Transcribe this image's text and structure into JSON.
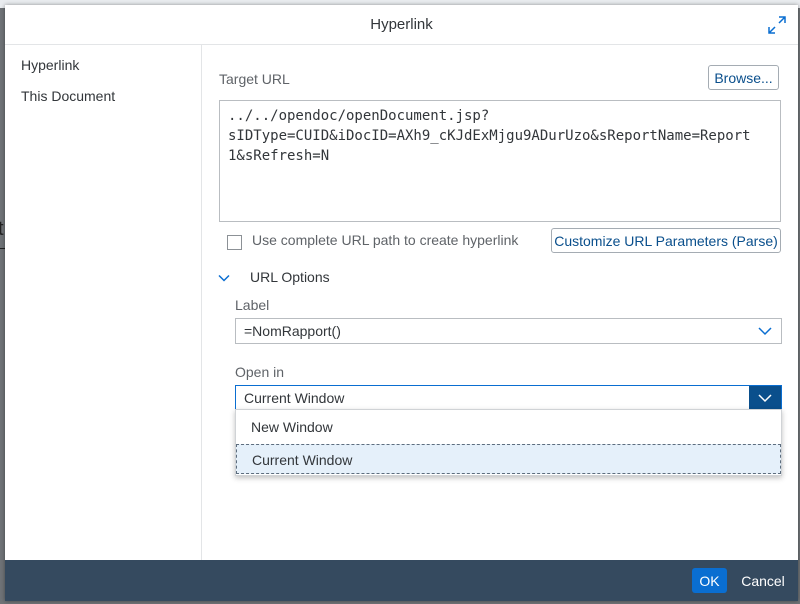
{
  "dialog": {
    "title": "Hyperlink",
    "expand_icon": "expand-icon"
  },
  "nav": {
    "items": [
      {
        "label": "Hyperlink"
      },
      {
        "label": "This Document"
      }
    ]
  },
  "target_url": {
    "label": "Target URL",
    "browse_label": "Browse...",
    "value": "../../opendoc/openDocument.jsp?\nsIDType=CUID&iDocID=AXh9_cKJdExMjgu9ADurUzo&sReportName=Report\n1&sRefresh=N"
  },
  "complete_path": {
    "label": "Use complete URL path to create hyperlink",
    "checked": false
  },
  "customize_label": "Customize URL Parameters (Parse)",
  "url_options": {
    "title": "URL Options",
    "label_field": {
      "label": "Label",
      "value": "=NomRapport()"
    },
    "open_in": {
      "label": "Open in",
      "value": "Current Window",
      "options": [
        "New Window",
        "Current Window"
      ],
      "selected_index": 1
    }
  },
  "footer": {
    "ok_label": "OK",
    "cancel_label": "Cancel"
  },
  "colors": {
    "accent": "#0a6ed1",
    "footer_bg": "#354a5f",
    "link_text": "#0a4f8c"
  }
}
